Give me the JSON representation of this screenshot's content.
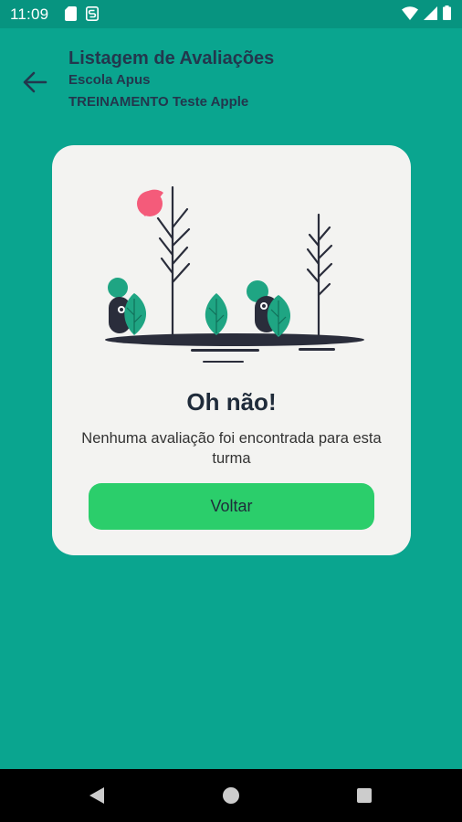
{
  "status_bar": {
    "time": "11:09",
    "left_icons": [
      "sd-card-icon",
      "sync-icon"
    ],
    "right_icons": [
      "wifi-icon",
      "signal-icon",
      "battery-icon"
    ]
  },
  "header": {
    "title": "Listagem de Avaliações",
    "school": "Escola Apus",
    "class_name": "TREINAMENTO Teste Apple",
    "back_icon": "arrow-left-icon"
  },
  "empty_state": {
    "illustration": "trees-and-creatures-illustration",
    "heading": "Oh não!",
    "message": "Nenhuma avaliação foi encontrada para esta turma",
    "button_label": "Voltar"
  },
  "colors": {
    "background": "#0aa58f",
    "status_bar": "#079480",
    "card": "#f3f3f1",
    "button": "#2bce6b",
    "title_text": "#23374d",
    "leaf": "#1fa583",
    "sun": "#f45b7a"
  },
  "nav_bar": {
    "icons": [
      "nav-back-icon",
      "nav-home-icon",
      "nav-recents-icon"
    ]
  }
}
